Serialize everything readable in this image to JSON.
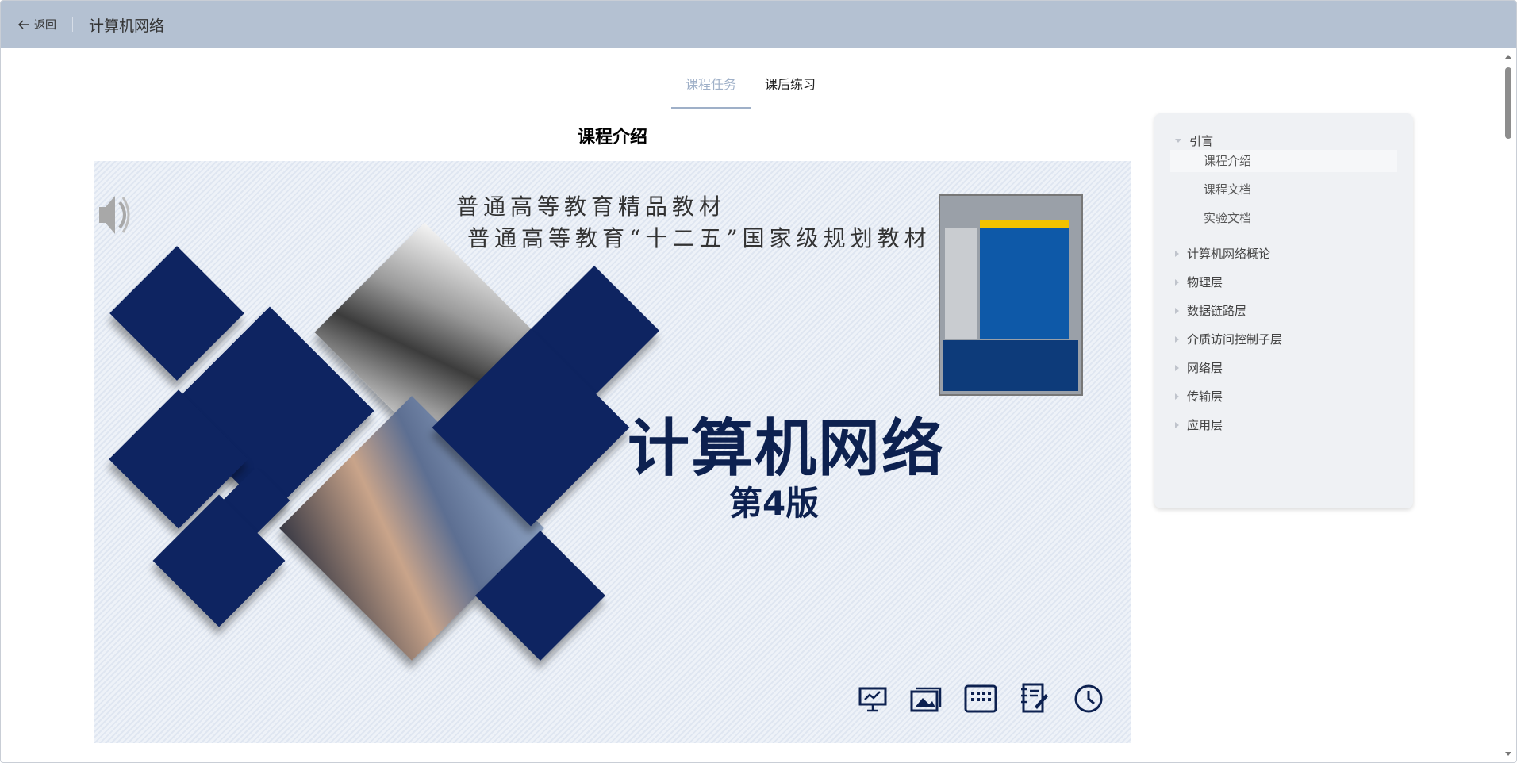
{
  "header": {
    "back_label": "返回",
    "title": "计算机网络"
  },
  "tabs": [
    {
      "label": "课程任务",
      "active": true
    },
    {
      "label": "课后练习",
      "active": false
    }
  ],
  "main": {
    "section_title": "课程介绍",
    "slide": {
      "line1": "普通高等教育精品教材",
      "line2": "普通高等教育“十二五”国家级规划教材",
      "title": "计算机网络",
      "subtitle": "第4版",
      "toolbar_icons": [
        "presentation-icon",
        "gallery-icon",
        "keypad-icon",
        "notebook-edit-icon",
        "clock-icon"
      ]
    }
  },
  "sidebar": {
    "chapters": [
      {
        "label": "引言",
        "expanded": true,
        "items": [
          {
            "label": "课程介绍",
            "active": true
          },
          {
            "label": "课程文档",
            "active": false
          },
          {
            "label": "实验文档",
            "active": false
          }
        ]
      },
      {
        "label": "计算机网络概论",
        "expanded": false
      },
      {
        "label": "物理层",
        "expanded": false
      },
      {
        "label": "数据链路层",
        "expanded": false
      },
      {
        "label": "介质访问控制子层",
        "expanded": false
      },
      {
        "label": "网络层",
        "expanded": false
      },
      {
        "label": "传输层",
        "expanded": false
      },
      {
        "label": "应用层",
        "expanded": false
      }
    ]
  },
  "colors": {
    "header_bg": "#b4c1d2",
    "accent": "#9fb0c8",
    "slide_navy": "#0e2461"
  }
}
